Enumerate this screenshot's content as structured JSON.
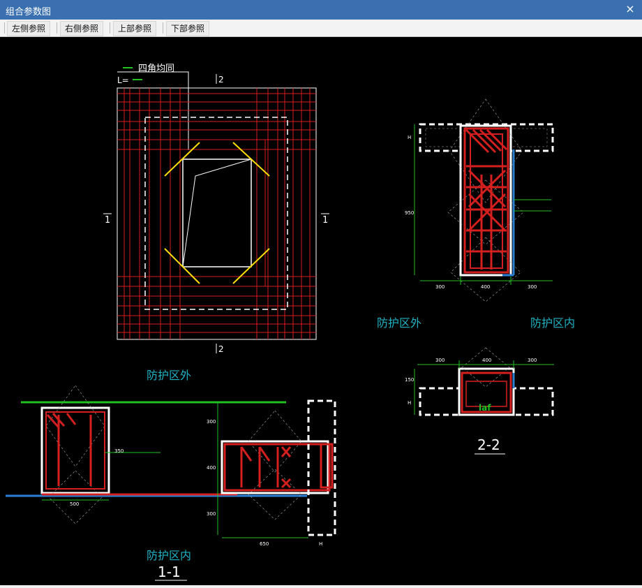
{
  "window": {
    "title": "组合参数图",
    "close_glyph": "×"
  },
  "toolbar": {
    "buttons": [
      {
        "label": "左侧参照"
      },
      {
        "label": "右侧参照"
      },
      {
        "label": "上部参照"
      },
      {
        "label": "下部参照"
      }
    ]
  },
  "drawing": {
    "plan": {
      "legend_text": "四角均同",
      "legend_prefix": "L=",
      "section_mark_top": "2",
      "section_mark_bottom": "2",
      "section_mark_left": "1",
      "section_mark_right": "1"
    },
    "section_2_2": {
      "dim_h": "H",
      "dim_950": "950",
      "dim_left": "300",
      "dim_mid": "400",
      "dim_right": "300",
      "label_outside": "防护区外",
      "label_inside": "防护区内"
    },
    "section_2_2_bottom": {
      "dim_left": "300",
      "dim_mid": "400",
      "dim_right": "300",
      "dim_150": "150",
      "dim_h": "H",
      "laf": "laf",
      "title": "2-2"
    },
    "section_1_1": {
      "label_outside": "防护区外",
      "label_inside": "防护区内",
      "dim_500": "500",
      "dim_350": "350",
      "dim_300_top": "300",
      "dim_400": "400",
      "dim_300_bottom": "300",
      "dim_650": "650",
      "dim_h": "H",
      "title": "1-1"
    }
  },
  "colors": {
    "titlebar": "#3a6fb0",
    "canvas": "#000000",
    "rebar_red": "#d41f1f",
    "concrete_white": "#ffffff",
    "annotation_green": "#22c022",
    "highlight_yellow": "#ffe000",
    "line_blue": "#2a7fd4",
    "label_cyan": "#1fb2c4"
  }
}
